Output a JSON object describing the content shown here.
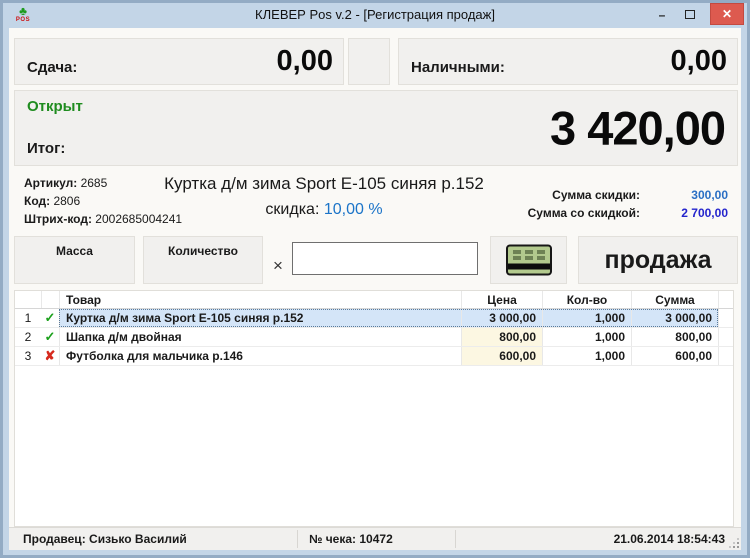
{
  "window": {
    "title": "КЛЕВЕР Pos v.2 - [Регистрация продаж]",
    "controls": {
      "minimize_glyph": "–",
      "close_glyph": "✕"
    },
    "app_icon": {
      "clover_glyph": "♣",
      "pos_label": "POS"
    }
  },
  "payment": {
    "change_label": "Сдача:",
    "change_value": "0,00",
    "cash_label": "Наличными:",
    "cash_value": "0,00"
  },
  "receipt": {
    "status": "Открыт",
    "total_label": "Итог:",
    "total_value": "3 420,00"
  },
  "item_info": {
    "article_label": "Артикул:",
    "article_value": "2685",
    "code_label": "Код:",
    "code_value": "2806",
    "barcode_label": "Штрих-код:",
    "barcode_value": "2002685004241",
    "product_name": "Куртка д/м зима Sport E-105 синяя р.152",
    "discount_label": "скидка:",
    "discount_value": "10,00 %",
    "discount_sum_label": "Сумма скидки:",
    "discount_sum_value": "300,00",
    "discounted_total_label": "Сумма со скидкой:",
    "discounted_total_value": "2 700,00"
  },
  "actions": {
    "mass_button_label": "Масса",
    "quantity_button_label": "Количество",
    "multiply_sign": "×",
    "quantity_input_value": "",
    "sale_button_label": "продажа"
  },
  "table": {
    "headers": {
      "product": "Товар",
      "price": "Цена",
      "qty": "Кол-во",
      "sum": "Сумма"
    },
    "rows": [
      {
        "num": "1",
        "status": "included",
        "status_glyph": "✓",
        "selected": true,
        "product": "Куртка д/м зима Sport E-105 синяя р.152",
        "price": "3 000,00",
        "qty": "1,000",
        "sum": "3 000,00"
      },
      {
        "num": "2",
        "status": "included",
        "status_glyph": "✓",
        "selected": false,
        "product": "Шапка д/м двойная",
        "price": "800,00",
        "qty": "1,000",
        "sum": "800,00"
      },
      {
        "num": "3",
        "status": "excluded",
        "status_glyph": "✘",
        "selected": false,
        "product": "Футболка для мальчика р.146",
        "price": "600,00",
        "qty": "1,000",
        "sum": "600,00"
      }
    ]
  },
  "status_bar": {
    "seller_label": "Продавец:",
    "seller_value": "Сизько Василий",
    "receipt_no_label": "№ чека:",
    "receipt_no_value": "10472",
    "datetime": "21.06.2014 18:54:43"
  },
  "colors": {
    "window_frame": "#93abc4",
    "titlebar": "#c3d5e7",
    "close_button": "#dd5a4f",
    "status_open_green": "#1f8c1f",
    "discount_blue": "#1b74c8",
    "final_sum_blue": "#2424cc",
    "selection_blue": "#d4e5f8",
    "price_cell_cream": "#fcf7e2",
    "check_green": "#1ba01b",
    "cross_red": "#d62a1e"
  }
}
